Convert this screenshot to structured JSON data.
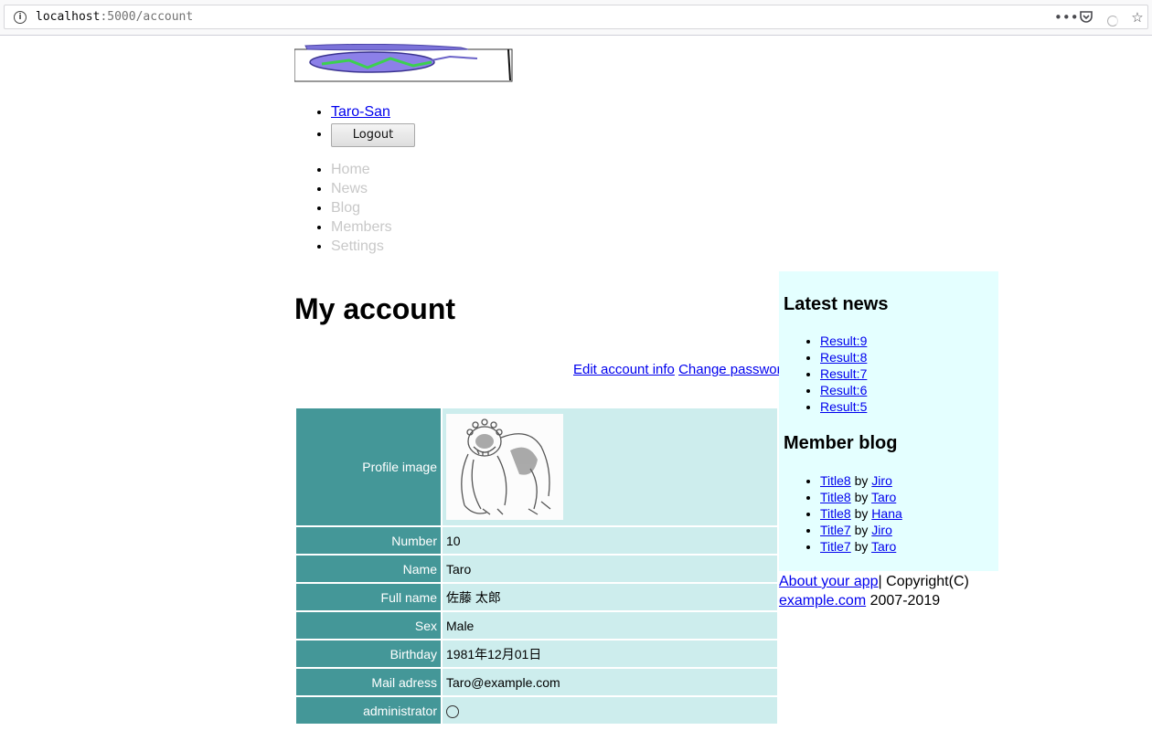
{
  "browser": {
    "url_host": "localhost",
    "url_rest": ":5000/account"
  },
  "user_menu": {
    "user_name": "Taro-San",
    "logout_label": "Logout"
  },
  "nav": {
    "items": [
      {
        "label": "Home"
      },
      {
        "label": "News"
      },
      {
        "label": "Blog"
      },
      {
        "label": "Members"
      },
      {
        "label": "Settings"
      }
    ]
  },
  "main": {
    "title": "My account",
    "edit_link": "Edit account info",
    "password_link": "Change password",
    "fields": {
      "profile_image": "Profile image",
      "number_label": "Number",
      "number_value": "10",
      "name_label": "Name",
      "name_value": "Taro",
      "fullname_label": "Full name",
      "fullname_value": "佐藤 太郎",
      "sex_label": "Sex",
      "sex_value": "Male",
      "birthday_label": "Birthday",
      "birthday_value": "1981年12月01日",
      "mail_label": "Mail adress",
      "mail_value": "Taro@example.com",
      "admin_label": "administrator"
    }
  },
  "sidebar": {
    "news_title": "Latest news",
    "news": [
      {
        "label": "Result:9"
      },
      {
        "label": "Result:8"
      },
      {
        "label": "Result:7"
      },
      {
        "label": "Result:6"
      },
      {
        "label": "Result:5"
      }
    ],
    "blog_title": "Member blog",
    "blog": [
      {
        "title": "Title8",
        "by": "by",
        "author": "Jiro"
      },
      {
        "title": "Title8",
        "by": "by",
        "author": "Taro"
      },
      {
        "title": "Title8",
        "by": "by",
        "author": "Hana"
      },
      {
        "title": "Title7",
        "by": "by",
        "author": "Jiro"
      },
      {
        "title": "Title7",
        "by": "by",
        "author": "Taro"
      }
    ]
  },
  "footer": {
    "about_link": "About your app",
    "copyright": "| Copyright(C)",
    "site_link": "example.com",
    "years": " 2007-2019"
  }
}
